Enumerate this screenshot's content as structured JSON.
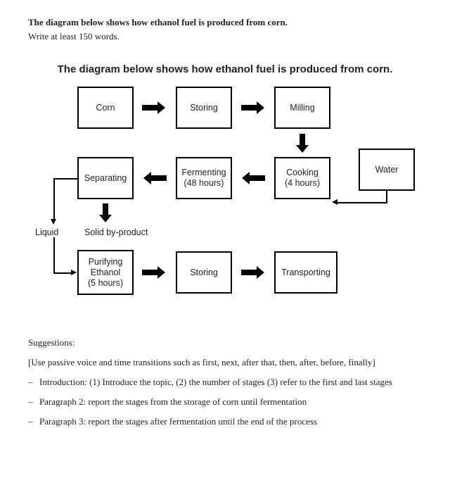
{
  "prompt": {
    "title": "The diagram below shows how ethanol fuel is produced from corn.",
    "subtitle": "Write at least 150 words."
  },
  "diagram": {
    "title": "The diagram below shows how ethanol fuel is produced from corn.",
    "boxes": {
      "corn": "Corn",
      "storing1": "Storing",
      "milling": "Milling",
      "water": "Water",
      "cooking": "Cooking",
      "cooking_time": "(4 hours)",
      "fermenting": "Fermenting",
      "fermenting_time": "(48 hours)",
      "separating": "Separating",
      "purifying": "Purifying",
      "purifying_sub": "Ethanol",
      "purifying_time": "(5 hours)",
      "storing2": "Storing",
      "transporting": "Transporting"
    },
    "labels": {
      "liquid": "Liquid",
      "solid": "Solid by-product"
    }
  },
  "suggestions": {
    "heading": "Suggestions:",
    "note": "Use passive voice and time transitions such as first, next, after that, then, after, before, finally",
    "items": [
      "Introduction: (1) Introduce the topic, (2) the number of stages (3) refer to the first and last stages",
      "Paragraph 2: report the stages from the storage of corn until fermentation",
      "Paragraph 3: report the stages after fermentation until the end of the process"
    ]
  }
}
